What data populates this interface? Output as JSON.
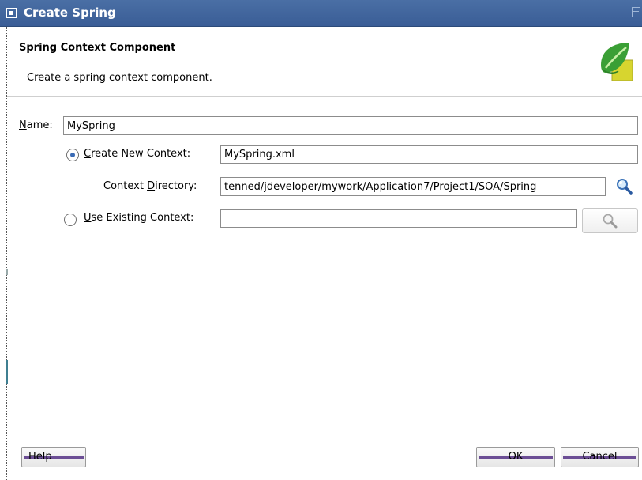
{
  "window": {
    "title": "Create Spring"
  },
  "header": {
    "title": "Spring Context Component",
    "subtitle": "Create a spring context component."
  },
  "form": {
    "name_label": "Name:",
    "name_value": "MySpring",
    "create_new": {
      "label": "Create New Context:",
      "selected": true,
      "value": "MySpring.xml"
    },
    "context_directory": {
      "label": "Context Directory:",
      "value": "tenned/jdeveloper/mywork/Application7/Project1/SOA/Spring"
    },
    "use_existing": {
      "label": "Use Existing Context:",
      "selected": false,
      "value": ""
    }
  },
  "footer": {
    "help_label": "Help",
    "ok_label": "OK",
    "cancel_label": "Cancel"
  },
  "icons": {
    "window_menu": "window-menu-icon",
    "maximize": "maximize-icon",
    "spring_logo": "spring-leaf-icon",
    "browse_directory": "magnifier-icon",
    "browse_existing": "magnifier-icon"
  },
  "colors": {
    "titlebar": "#3f649d",
    "accent": "#3b6bb5",
    "button_stripe": "#6c4e95"
  }
}
